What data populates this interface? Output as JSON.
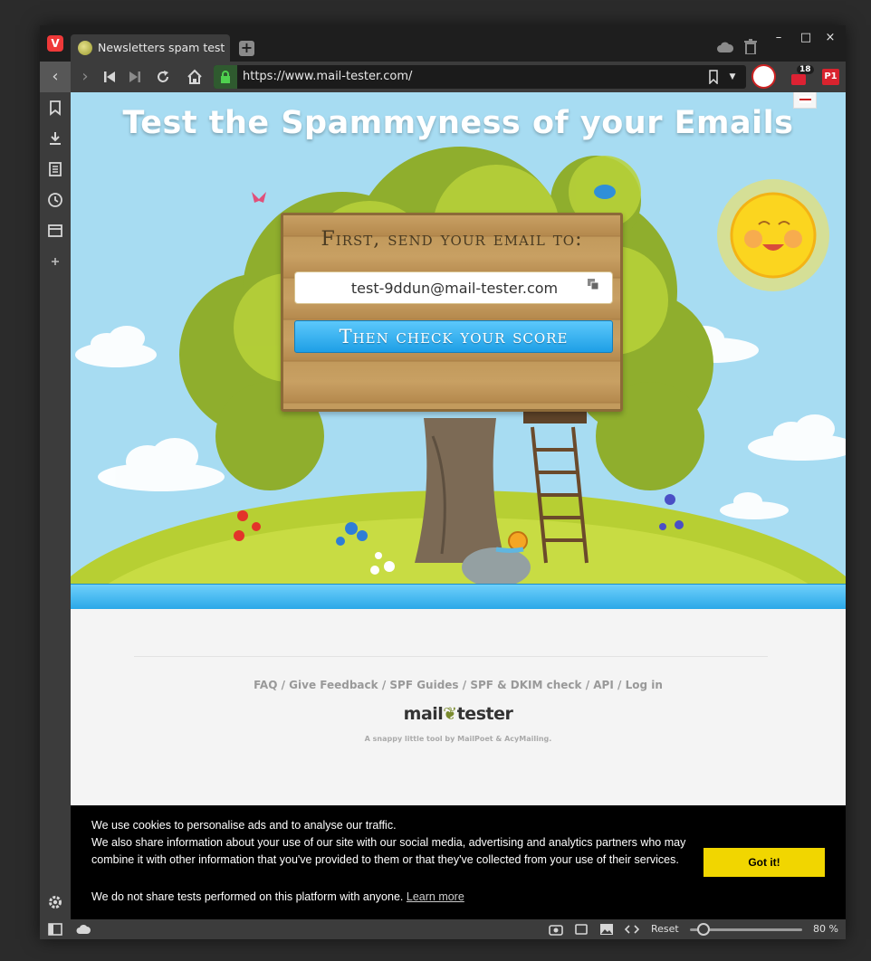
{
  "browser": {
    "tab_title": "Newsletters spam test by mail-tester.com",
    "url": "https://www.mail-tester.com/",
    "extension_badge_count": "18",
    "extension_p1_label": "P1",
    "window_controls": {
      "minimize": "–",
      "maximize": "□",
      "close": "×"
    }
  },
  "status_bar": {
    "reset_label": "Reset",
    "zoom_label": "80 %",
    "zoom_level_percent": 80
  },
  "page": {
    "hero_title": "Test the Spammyness of your Emails",
    "send_heading": "First, send your email to:",
    "email_address": "test-9ddun@mail-tester.com",
    "check_button": "Then check your score",
    "footer_links": [
      "FAQ",
      "Give Feedback",
      "SPF Guides",
      "SPF & DKIM check",
      "API",
      "Log in"
    ],
    "footer_separator": "/",
    "logo_left": "mail",
    "logo_right": "tester",
    "tagline": "A snappy little tool by MailPoet & AcyMailing."
  },
  "cookie_banner": {
    "line1": "We use cookies to personalise ads and to analyse our traffic.",
    "line2": "We also share information about your use of our site with our social media, advertising and analytics partners who may",
    "line3": "combine it with other information that you've provided to them or that they've collected from your use of their services.",
    "line4": "We do not share tests performed on this platform with anyone.",
    "learn_more": "Learn more",
    "accept_button": "Got it!"
  },
  "colors": {
    "sky": "#a7dcf2",
    "accent_blue": "#1e9fe6",
    "cookie_button": "#f1d600"
  }
}
